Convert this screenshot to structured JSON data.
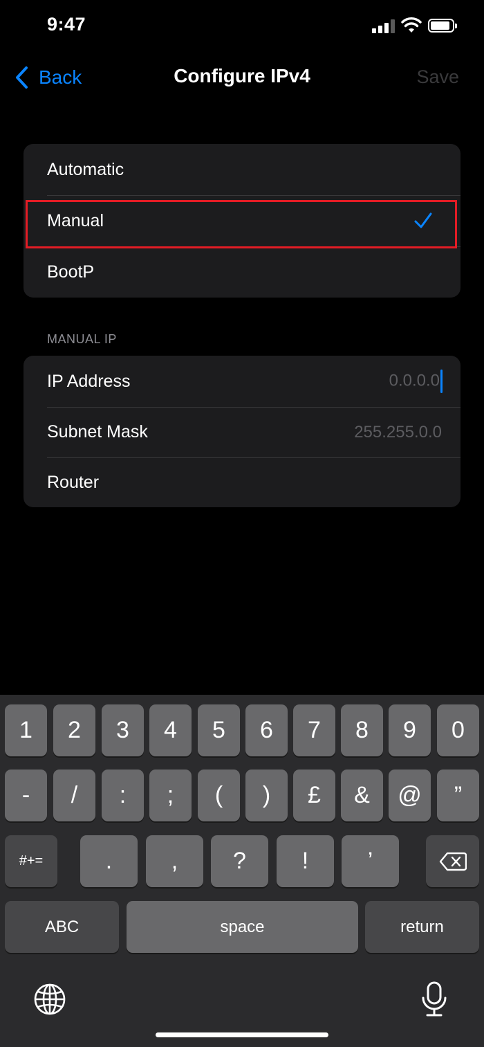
{
  "status": {
    "time": "9:47"
  },
  "nav": {
    "back_label": "Back",
    "title": "Configure IPv4",
    "save_label": "Save"
  },
  "modes": {
    "items": [
      {
        "label": "Automatic",
        "selected": false
      },
      {
        "label": "Manual",
        "selected": true
      },
      {
        "label": "BootP",
        "selected": false
      }
    ]
  },
  "manual_ip": {
    "header": "MANUAL IP",
    "ip_label": "IP Address",
    "ip_placeholder": "0.0.0.0",
    "subnet_label": "Subnet Mask",
    "subnet_placeholder": "255.255.0.0",
    "router_label": "Router"
  },
  "keyboard": {
    "row1": [
      "1",
      "2",
      "3",
      "4",
      "5",
      "6",
      "7",
      "8",
      "9",
      "0"
    ],
    "row2": [
      "-",
      "/",
      ":",
      ";",
      "(",
      ")",
      "£",
      "&",
      "@",
      "”"
    ],
    "row3": [
      ".",
      ",",
      "?",
      "!",
      "’"
    ],
    "symbols_key": "#+=",
    "abc_key": "ABC",
    "space_key": "space",
    "return_key": "return",
    "icons": [
      "globe-icon",
      "microphone-icon",
      "delete-icon"
    ]
  },
  "colors": {
    "accent": "#0a84ff",
    "highlight": "#e31c25",
    "cell": "#1c1c1e"
  }
}
